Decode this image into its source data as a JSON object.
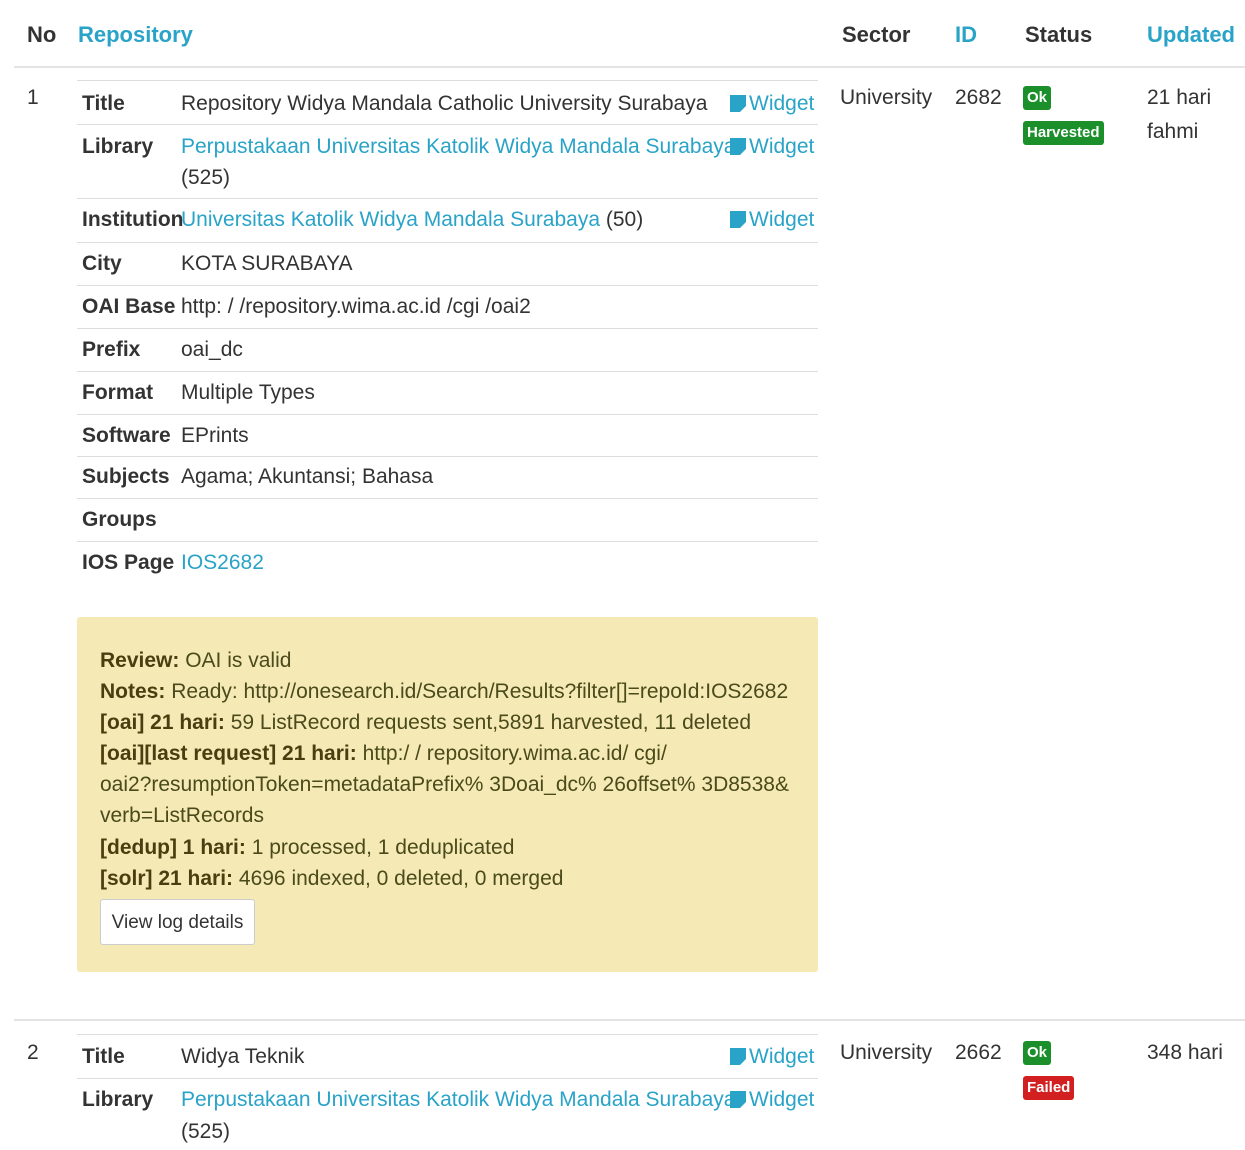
{
  "header": {
    "no": "No",
    "repository": "Repository",
    "sector": "Sector",
    "id": "ID",
    "status": "Status",
    "updated": "Updated"
  },
  "widget_label": "Widget",
  "records": [
    {
      "no": "1",
      "sector": "University",
      "id": "2682",
      "status_ok": "Ok",
      "status_state": "Harvested",
      "updated": "21 hari",
      "updated_by": "fahmi",
      "fields": {
        "title_label": "Title",
        "title": "Repository Widya Mandala Catholic University Surabaya",
        "library_label": "Library",
        "library": "Perpustakaan Universitas Katolik Widya Mandala Surabaya",
        "library_count": "(525)",
        "institution_label": "Institution",
        "institution": "Universitas Katolik Widya Mandala Surabaya",
        "institution_count": "(50)",
        "city_label": "City",
        "city": "KOTA SURABAYA",
        "oai_base_label": "OAI Base",
        "oai_base": "http: / /repository.wima.ac.id /cgi /oai2",
        "prefix_label": "Prefix",
        "prefix": "oai_dc",
        "format_label": "Format",
        "format": "Multiple Types",
        "software_label": "Software",
        "software": "EPrints",
        "subjects_label": "Subjects",
        "subjects": "Agama; Akuntansi; Bahasa",
        "groups_label": "Groups",
        "groups": "",
        "ios_page_label": "IOS Page",
        "ios_page": "IOS2682"
      },
      "review": {
        "review_label": "Review:",
        "review_text": "OAI is valid",
        "notes_label": "Notes:",
        "notes_text": "Ready: http://onesearch.id/Search/Results?filter[]=repoId:IOS2682",
        "oai_label": "[oai] 21 hari:",
        "oai_text": "59 ListRecord requests sent,5891 harvested, 11 deleted",
        "last_request_label": "[oai][last request] 21 hari:",
        "last_request_text_1": "http:/ / repository.wima.ac.id/ cgi/",
        "last_request_text_2": "oai2?resumptionToken=metadataPrefix% 3Doai_dc% 26offset% 3D8538&",
        "last_request_text_3": "verb=ListRecords",
        "dedup_label": "[dedup] 1 hari:",
        "dedup_text": "1 processed, 1 deduplicated",
        "solr_label": "[solr] 21 hari:",
        "solr_text": "4696 indexed, 0 deleted, 0 merged",
        "view_log_button": "View log details"
      }
    },
    {
      "no": "2",
      "sector": "University",
      "id": "2662",
      "status_ok": "Ok",
      "status_state": "Failed",
      "updated": "348 hari",
      "fields": {
        "title_label": "Title",
        "title": "Widya Teknik",
        "library_label": "Library",
        "library": "Perpustakaan Universitas Katolik Widya Mandala Surabaya",
        "library_count": "(525)"
      }
    }
  ],
  "colors": {
    "link": "#29a3c8",
    "ok_badge": "#1b8f2a",
    "failed_badge": "#d21f1f",
    "review_bg": "#f5eab6"
  }
}
